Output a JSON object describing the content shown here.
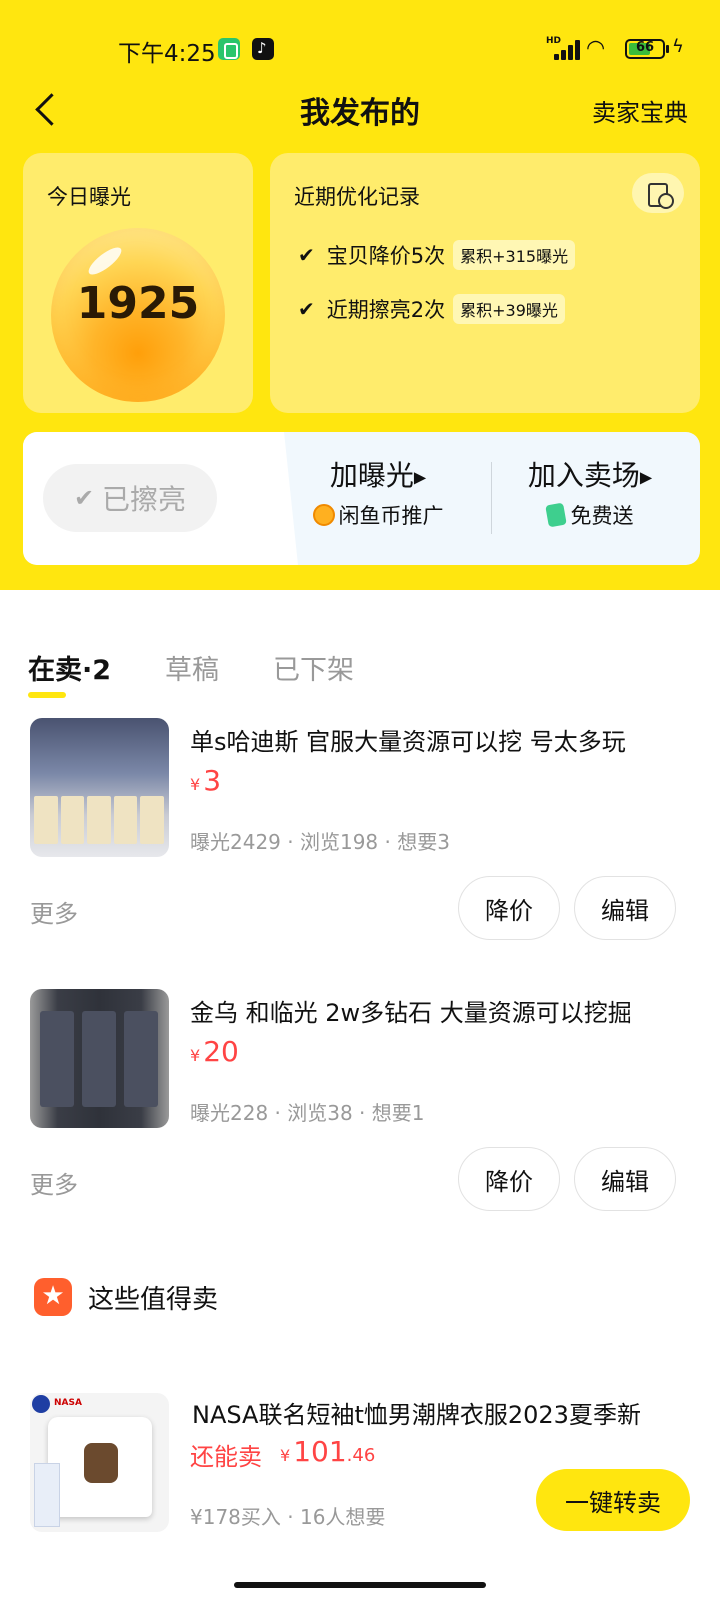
{
  "status_bar": {
    "time": "下午4:25",
    "battery": "66",
    "battery_level_percent": 66,
    "network": "HD"
  },
  "nav": {
    "title": "我发布的",
    "right_link": "卖家宝典"
  },
  "exposure_card": {
    "label": "今日曝光",
    "value": "1925"
  },
  "optimize_card": {
    "label": "近期优化记录",
    "rows": [
      {
        "text": "宝贝降价5次",
        "tag": "累积+315曝光"
      },
      {
        "text": "近期擦亮2次",
        "tag": "累积+39曝光"
      }
    ]
  },
  "actions": {
    "polished_label": "已擦亮",
    "boost": {
      "title": "加曝光",
      "subtitle": "闲鱼币推广"
    },
    "market": {
      "title": "加入卖场",
      "subtitle": "免费送"
    }
  },
  "tabs": [
    {
      "label": "在卖·2",
      "active": true
    },
    {
      "label": "草稿",
      "active": false
    },
    {
      "label": "已下架",
      "active": false
    }
  ],
  "products": [
    {
      "title": "单s哈迪斯 官服大量资源可以挖 号太多玩",
      "currency": "¥",
      "price": "3",
      "stats": "曝光2429 · 浏览198 · 想要3",
      "more": "更多",
      "cut_price": "降价",
      "edit": "编辑"
    },
    {
      "title": "金乌 和临光 2w多钻石 大量资源可以挖掘",
      "currency": "¥",
      "price": "20",
      "stats": "曝光228 · 浏览38 · 想要1",
      "more": "更多",
      "cut_price": "降价",
      "edit": "编辑"
    }
  ],
  "recommend": {
    "title": "这些值得卖",
    "item": {
      "title": "NASA联名短袖t恤男潮牌衣服2023夏季新",
      "price_label": "还能卖",
      "currency": "¥",
      "price_int": "101",
      "price_dec": ".46",
      "stats": "¥178买入 · 16人想要",
      "button": "一键转卖",
      "thumb_text": "NASA"
    }
  },
  "colors": {
    "brand_yellow": "#FFE60F",
    "price_red": "#FF4444",
    "muted_gray": "#999999"
  }
}
